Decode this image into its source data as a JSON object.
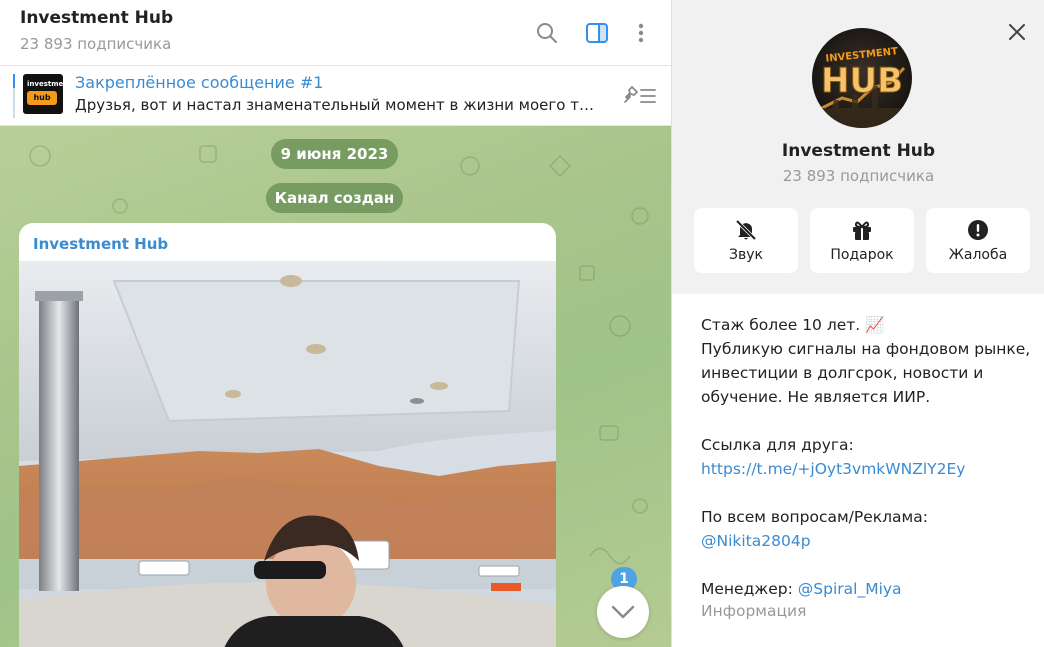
{
  "header": {
    "title": "Investment Hub",
    "subtitle": "23 893 подписчика"
  },
  "pinned": {
    "title": "Закреплённое сообщение #1",
    "text": "Друзья, вот и настал знаменательный момент в жизни моего тел...",
    "thumb_line1": "investment",
    "thumb_line2": "hub"
  },
  "service": {
    "date": "9 июня 2023",
    "created": "Канал создан"
  },
  "message": {
    "author": "Investment Hub"
  },
  "scroll": {
    "unread_count": "1"
  },
  "info_panel": {
    "name": "Investment Hub",
    "subscribers": "23 893 подписчика",
    "avatar_line1": "INVESTMENT",
    "avatar_line2": "HUB",
    "actions": [
      {
        "label": "Звук",
        "icon": "bell-off-icon"
      },
      {
        "label": "Подарок",
        "icon": "gift-icon"
      },
      {
        "label": "Жалоба",
        "icon": "alert-icon"
      }
    ],
    "about": {
      "line1": "Стаж более 10 лет. 📈",
      "line2": "Публикую сигналы на фондовом рынке,",
      "line3": "инвестиции в долгсрок, новости и",
      "line4": "обучение. Не является ИИР.",
      "friend_label": "Ссылка для друга:",
      "friend_link": "https://t.me/+jOyt3vmkWNZlY2Ey",
      "ads_label": "По всем вопросам/Реклама:",
      "ads_link": "@Nikita2804p",
      "manager_label": "Менеджер: ",
      "manager_link": "@Spiral_Miya",
      "caption": "Информация"
    }
  },
  "colors": {
    "accent": "#3a8bd0",
    "brand_orange": "#f39a1d",
    "chat_bg": "#a9c58c"
  }
}
